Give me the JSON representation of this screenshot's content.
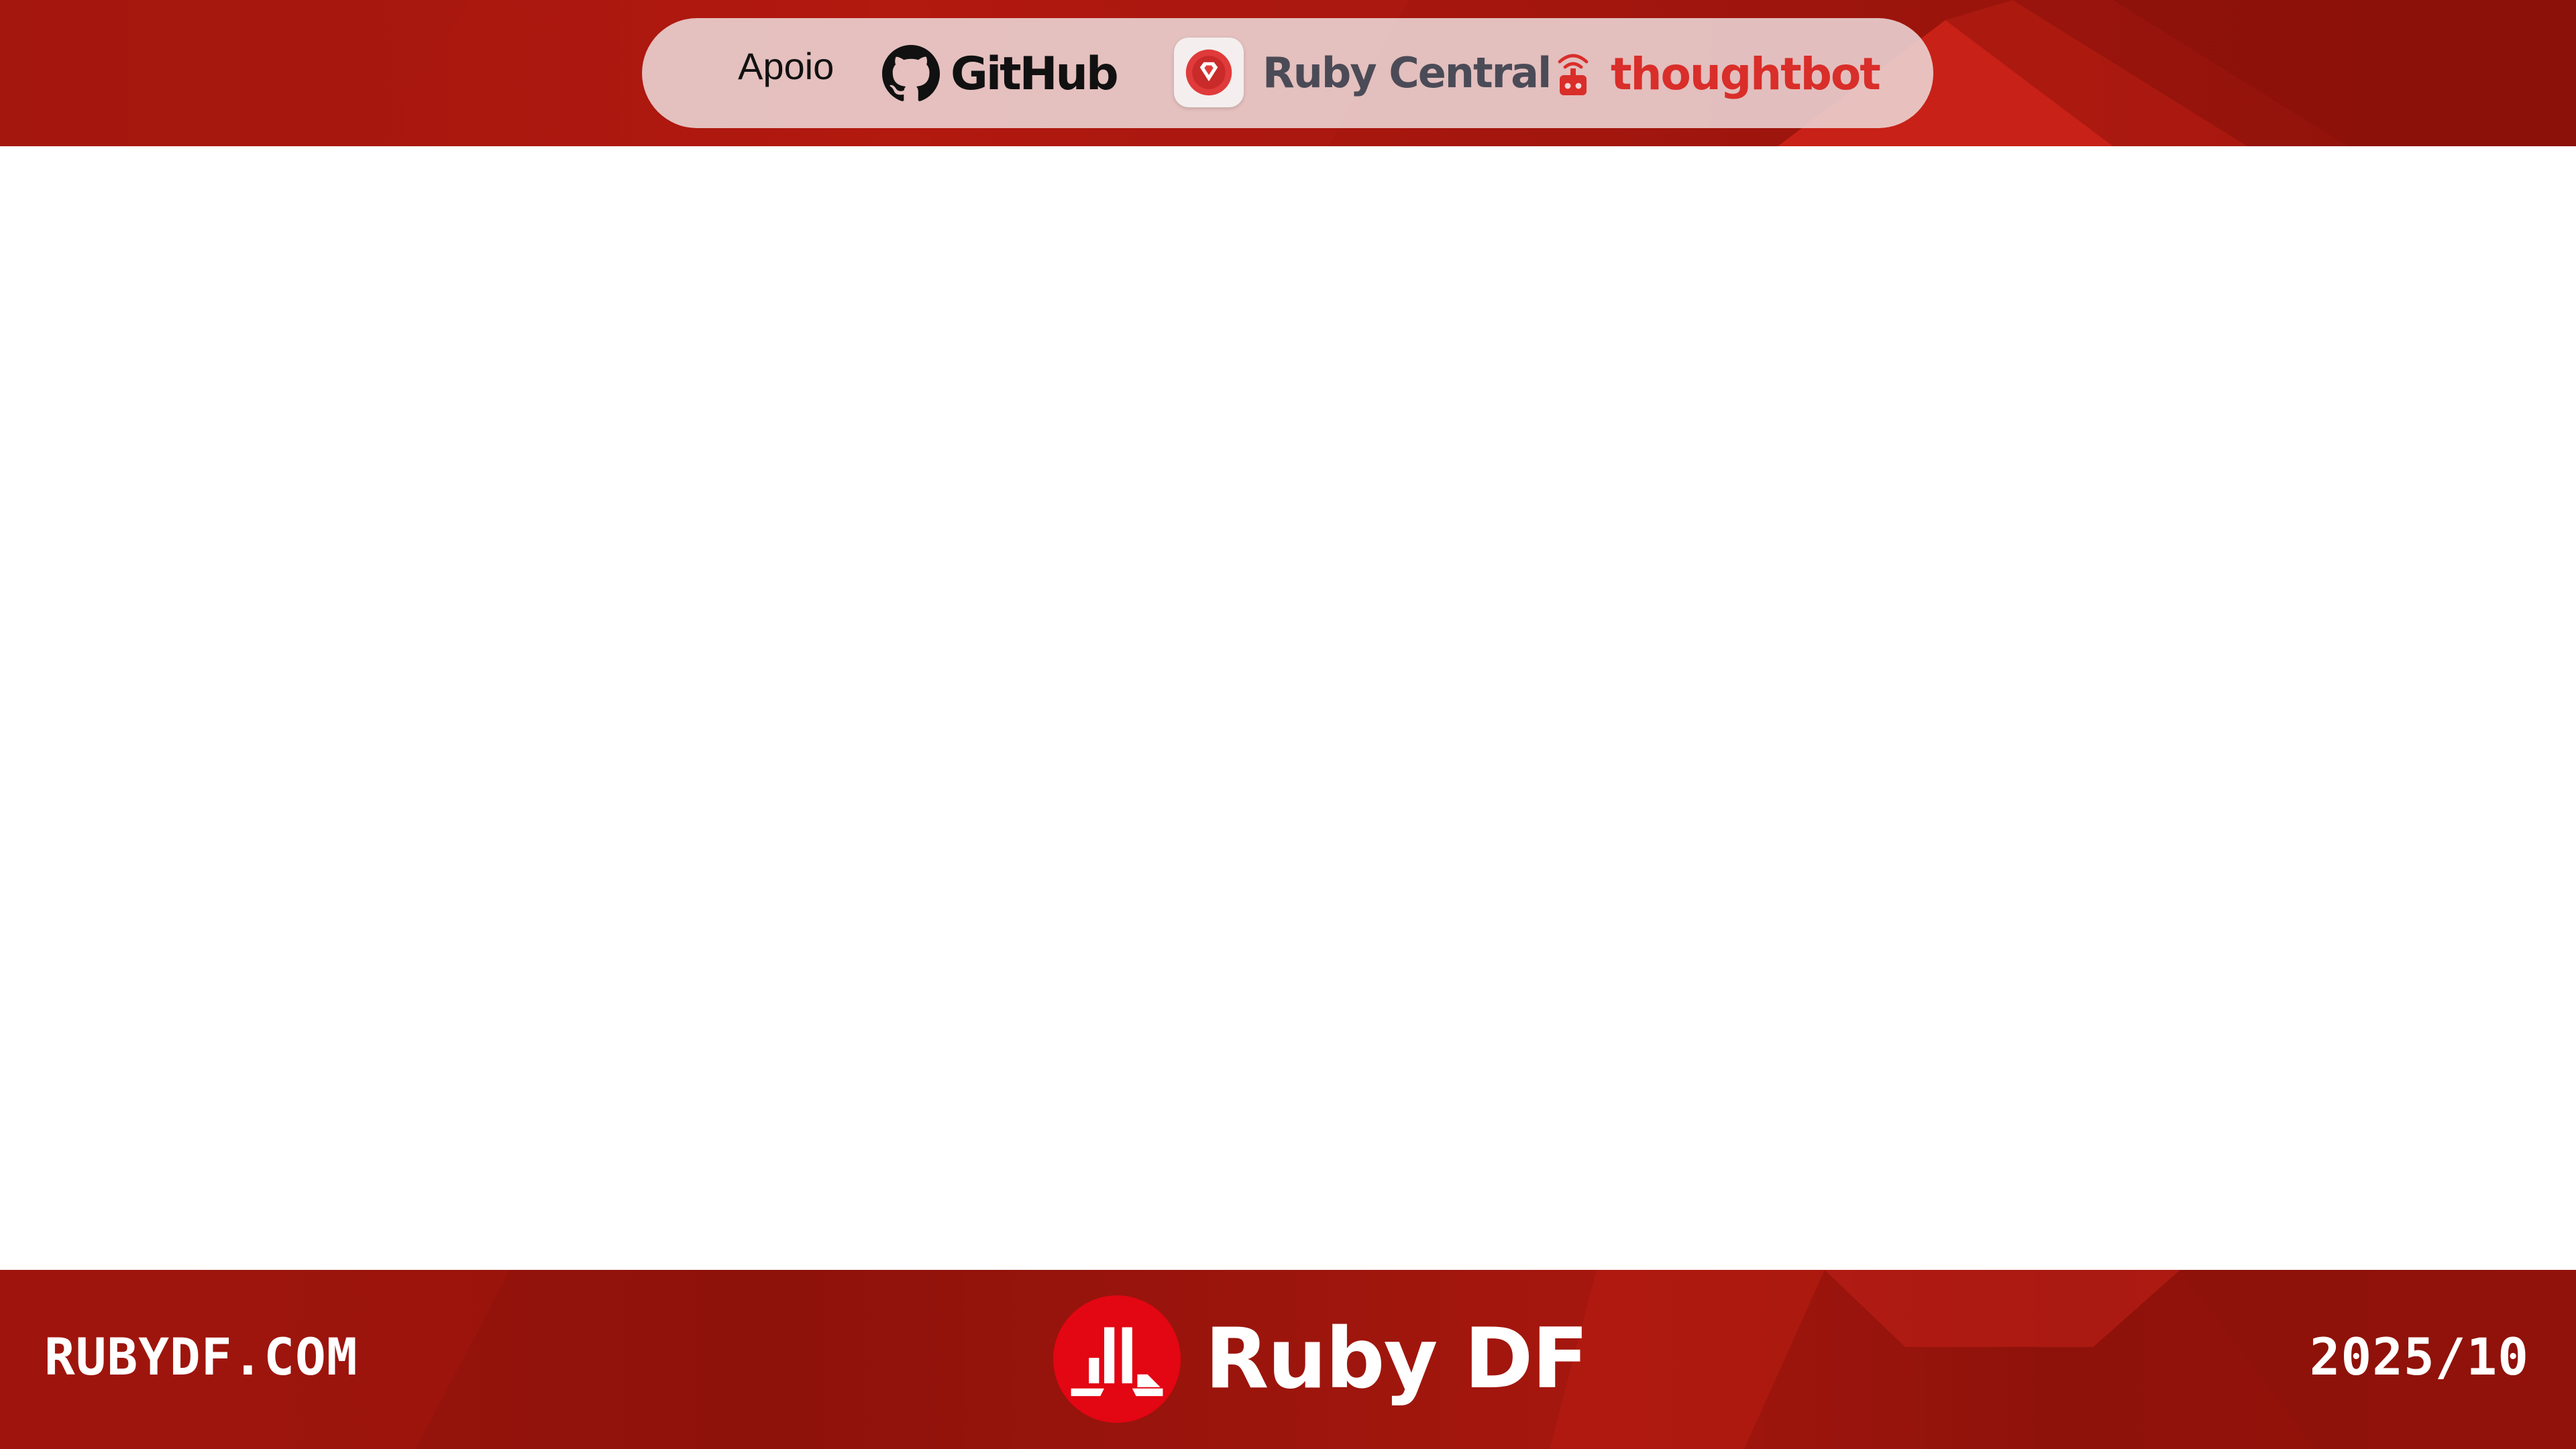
{
  "header": {
    "sponsor_label": "Apoio",
    "sponsors": [
      {
        "name": "GitHub",
        "icon": "github-octocat-icon",
        "color": "#111111"
      },
      {
        "name": "Ruby Central",
        "icon": "ruby-central-gem-icon",
        "color": "#4b4b57"
      },
      {
        "name": "thoughtbot",
        "icon": "thoughtbot-robot-icon",
        "color": "#d92e2a"
      }
    ]
  },
  "footer": {
    "site_url": "RUBYDF.COM",
    "brand_name": "Ruby DF",
    "brand_icon": "ruby-df-logo-icon",
    "date": "2025/10"
  },
  "colors": {
    "banner_red": "#a1160e",
    "banner_dark_red": "#8e120a",
    "logo_red": "#e30613",
    "pill_background": "#ecd7d7",
    "canvas": "#ffffff"
  }
}
